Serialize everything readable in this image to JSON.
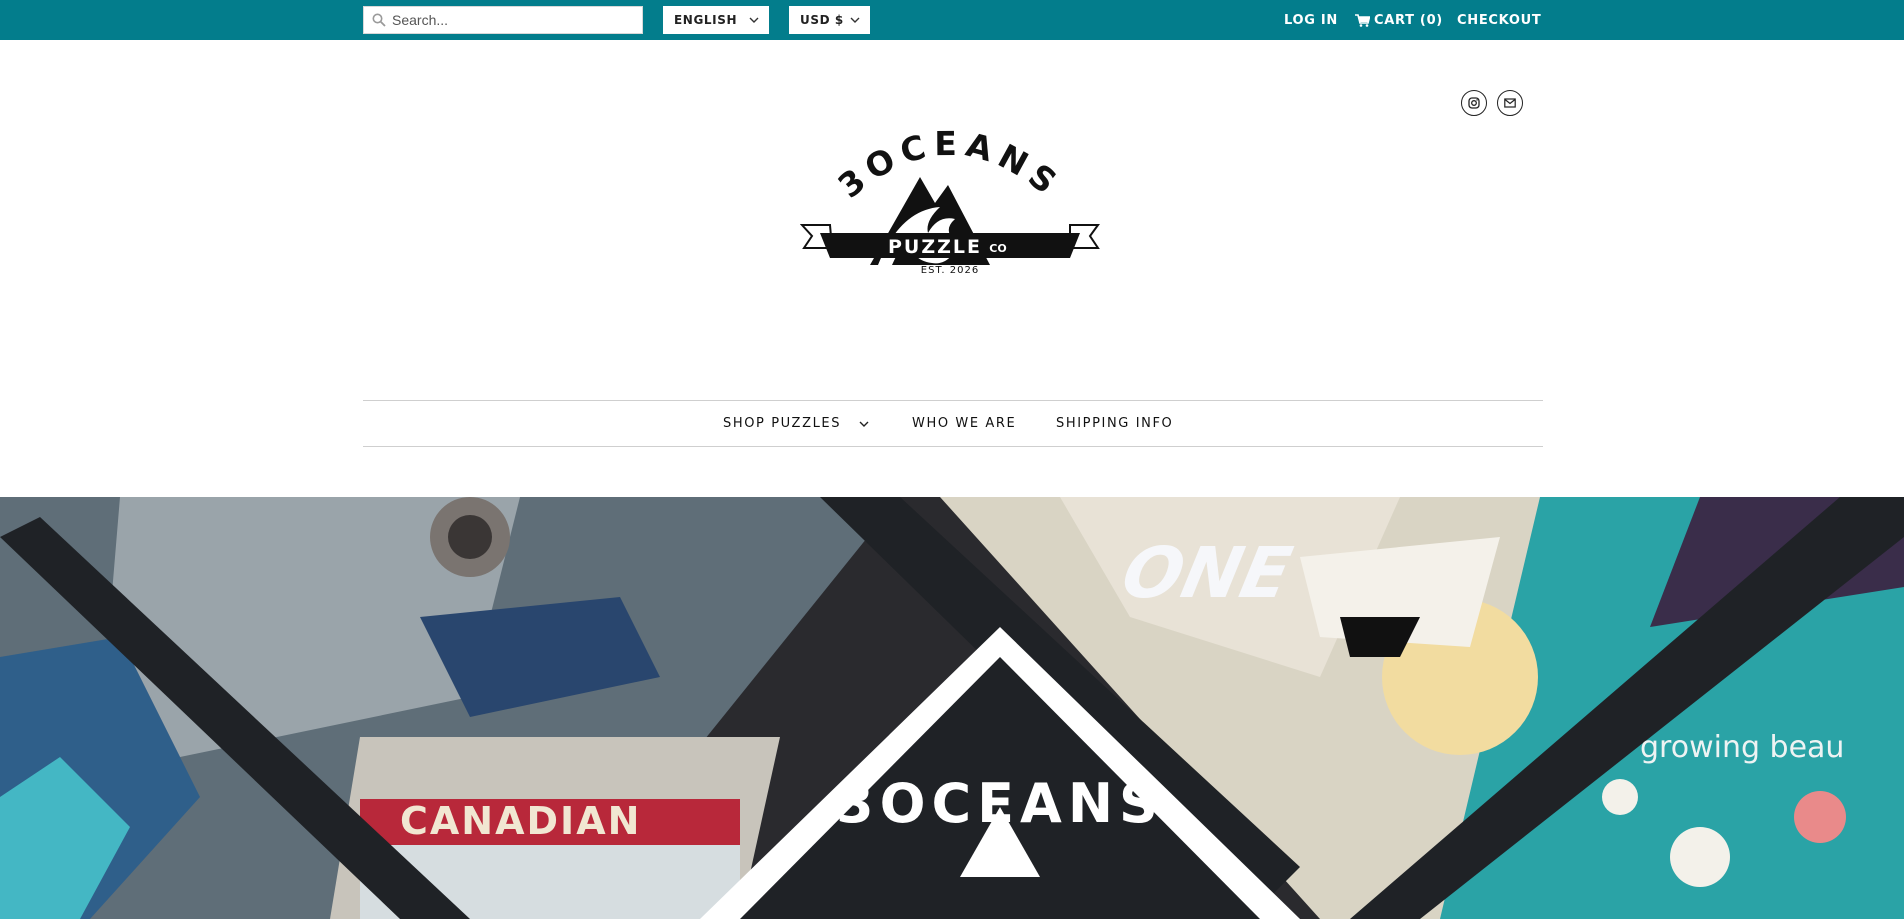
{
  "header": {
    "search": {
      "placeholder": "Search...",
      "value": ""
    },
    "language": {
      "selected": "ENGLISH"
    },
    "currency": {
      "selected": "USD $"
    },
    "links": {
      "login": "LOG IN",
      "cart": "CART (0)",
      "checkout": "CHECKOUT"
    },
    "bar_color": "#037d8c"
  },
  "social": {
    "icons": [
      "instagram-icon",
      "mail-icon"
    ]
  },
  "logo": {
    "brand_top": "3OCEANS",
    "banner": "PUZZLE",
    "banner_suffix": "CO",
    "established": "EST. 2026"
  },
  "nav": {
    "items": [
      {
        "label": "SHOP PUZZLES",
        "has_dropdown": true
      },
      {
        "label": "WHO WE ARE",
        "has_dropdown": false
      },
      {
        "label": "SHIPPING INFO",
        "has_dropdown": false
      }
    ]
  },
  "hero": {
    "visible_text": [
      "CANADIAN",
      "ONE",
      "growing beau",
      "3OCEANS"
    ]
  }
}
